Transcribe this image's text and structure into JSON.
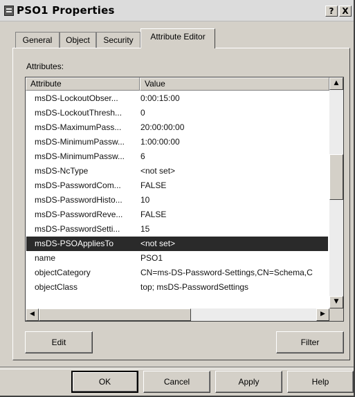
{
  "window": {
    "title": "PSO1 Properties",
    "help_btn": "?",
    "close_btn": "X"
  },
  "tabs": [
    {
      "label": "General"
    },
    {
      "label": "Object"
    },
    {
      "label": "Security"
    },
    {
      "label": "Attribute Editor"
    }
  ],
  "active_tab": "Attribute Editor",
  "attributes_label": "Attributes:",
  "columns": {
    "attribute": "Attribute",
    "value": "Value"
  },
  "rows": [
    {
      "attribute": "msDS-LockoutObser...",
      "value": "0:00:15:00"
    },
    {
      "attribute": "msDS-LockoutThresh...",
      "value": "0"
    },
    {
      "attribute": "msDS-MaximumPass...",
      "value": "20:00:00:00"
    },
    {
      "attribute": "msDS-MinimumPassw...",
      "value": "1:00:00:00"
    },
    {
      "attribute": "msDS-MinimumPassw...",
      "value": "6"
    },
    {
      "attribute": "msDS-NcType",
      "value": "<not set>"
    },
    {
      "attribute": "msDS-PasswordCom...",
      "value": "FALSE"
    },
    {
      "attribute": "msDS-PasswordHisto...",
      "value": "10"
    },
    {
      "attribute": "msDS-PasswordReve...",
      "value": "FALSE"
    },
    {
      "attribute": "msDS-PasswordSetti...",
      "value": "15"
    },
    {
      "attribute": "msDS-PSOAppliesTo",
      "value": "<not set>",
      "selected": true
    },
    {
      "attribute": "name",
      "value": "PSO1"
    },
    {
      "attribute": "objectCategory",
      "value": "CN=ms-DS-Password-Settings,CN=Schema,C"
    },
    {
      "attribute": "objectClass",
      "value": "top; msDS-PasswordSettings"
    }
  ],
  "buttons": {
    "edit": "Edit",
    "filter": "Filter",
    "ok": "OK",
    "cancel": "Cancel",
    "apply": "Apply",
    "help": "Help"
  },
  "scroll_arrows": {
    "up": "▲",
    "down": "▼",
    "left": "◀",
    "right": "▶"
  },
  "colors": {
    "selection": "#2a2a2a",
    "dialog_face": "#d4d0c8"
  }
}
